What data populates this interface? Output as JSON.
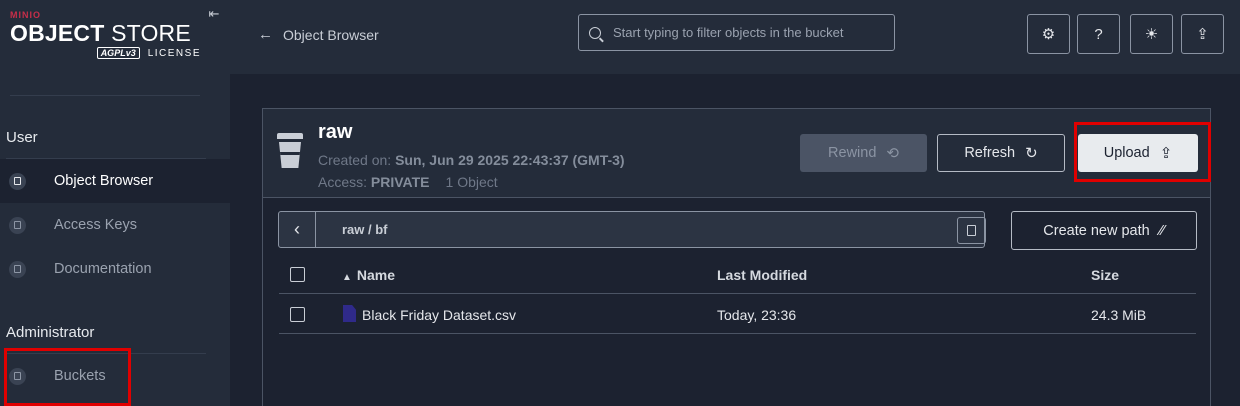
{
  "sidebar": {
    "logo": {
      "brand": "MINIO",
      "title_bold": "OBJECT",
      "title_rest": " STORE",
      "license_badge": "AGPLv3",
      "license_label": "LICENSE"
    },
    "collapse_icon": "⇤",
    "sections": [
      {
        "title": "User",
        "items": [
          {
            "label": "Object Browser",
            "icon": "object-browser-icon",
            "active": true
          },
          {
            "label": "Access Keys",
            "icon": "access-keys-icon",
            "active": false
          },
          {
            "label": "Documentation",
            "icon": "documentation-icon",
            "active": false
          }
        ]
      },
      {
        "title": "Administrator",
        "items": [
          {
            "label": "Buckets",
            "icon": "buckets-icon",
            "active": false
          }
        ]
      }
    ]
  },
  "topbar": {
    "back_arrow": "←",
    "back_label": "Object Browser",
    "search_placeholder": "Start typing to filter objects in the bucket",
    "icons": {
      "settings": "⚙",
      "help": "?",
      "theme": "☀",
      "upload": "⇪"
    }
  },
  "bucket": {
    "name": "raw",
    "created_label": "Created on:",
    "created_value": "Sun, Jun 29 2025 22:43:37 (GMT-3)",
    "access_label": "Access:",
    "access_value": "PRIVATE",
    "object_count": "1 Object",
    "buttons": {
      "rewind": "Rewind",
      "rewind_icon": "⟲",
      "refresh": "Refresh",
      "refresh_icon": "↻",
      "upload": "Upload",
      "upload_icon": "⇪"
    }
  },
  "path": {
    "back_icon": "‹",
    "text": "raw  /  bf",
    "create_new_path": "Create new path",
    "create_icon": "⁄⁄"
  },
  "table": {
    "sort_indicator": "▲",
    "headers": {
      "name": "Name",
      "modified": "Last Modified",
      "size": "Size"
    },
    "rows": [
      {
        "name": "Black Friday Dataset.csv",
        "modified": "Today, 23:36",
        "size": "24.3 MiB"
      }
    ]
  },
  "colors": {
    "accent_highlight": "#e00000",
    "background": "#1c2230",
    "panel": "#242c3a"
  }
}
